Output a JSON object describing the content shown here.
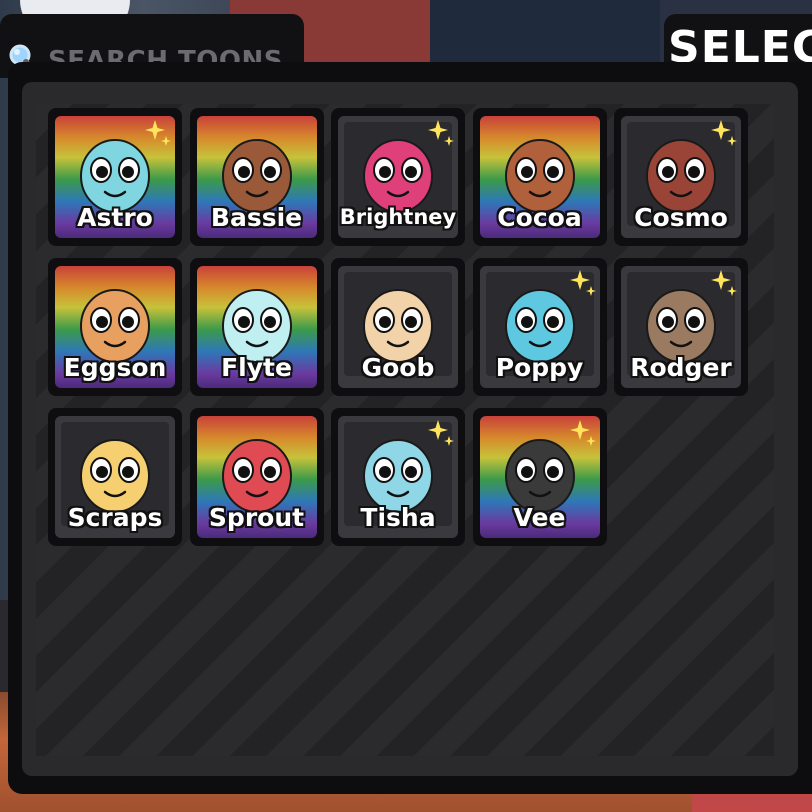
{
  "search": {
    "placeholder": "SEARCH TOONS",
    "value": ""
  },
  "title": "SELEC",
  "toons": [
    {
      "name": "Astro",
      "rainbow": true,
      "sparkle": true,
      "color": "#7fd6e0"
    },
    {
      "name": "Bassie",
      "rainbow": true,
      "sparkle": false,
      "color": "#9a5a3a"
    },
    {
      "name": "Brightney",
      "rainbow": false,
      "sparkle": true,
      "color": "#e0407a"
    },
    {
      "name": "Cocoa",
      "rainbow": true,
      "sparkle": false,
      "color": "#b0603a"
    },
    {
      "name": "Cosmo",
      "rainbow": false,
      "sparkle": true,
      "color": "#9a4438"
    },
    {
      "name": "Eggson",
      "rainbow": true,
      "sparkle": false,
      "color": "#e8a060"
    },
    {
      "name": "Flyte",
      "rainbow": true,
      "sparkle": false,
      "color": "#bfeff0"
    },
    {
      "name": "Goob",
      "rainbow": false,
      "sparkle": false,
      "color": "#f2d2a8"
    },
    {
      "name": "Poppy",
      "rainbow": false,
      "sparkle": true,
      "color": "#5ec8e0"
    },
    {
      "name": "Rodger",
      "rainbow": false,
      "sparkle": true,
      "color": "#9a7a60"
    },
    {
      "name": "Scraps",
      "rainbow": false,
      "sparkle": false,
      "color": "#f6d070"
    },
    {
      "name": "Sprout",
      "rainbow": true,
      "sparkle": false,
      "color": "#e04a52"
    },
    {
      "name": "Tisha",
      "rainbow": false,
      "sparkle": true,
      "color": "#8fd6e6"
    },
    {
      "name": "Vee",
      "rainbow": true,
      "sparkle": true,
      "color": "#3a3a3a"
    }
  ]
}
